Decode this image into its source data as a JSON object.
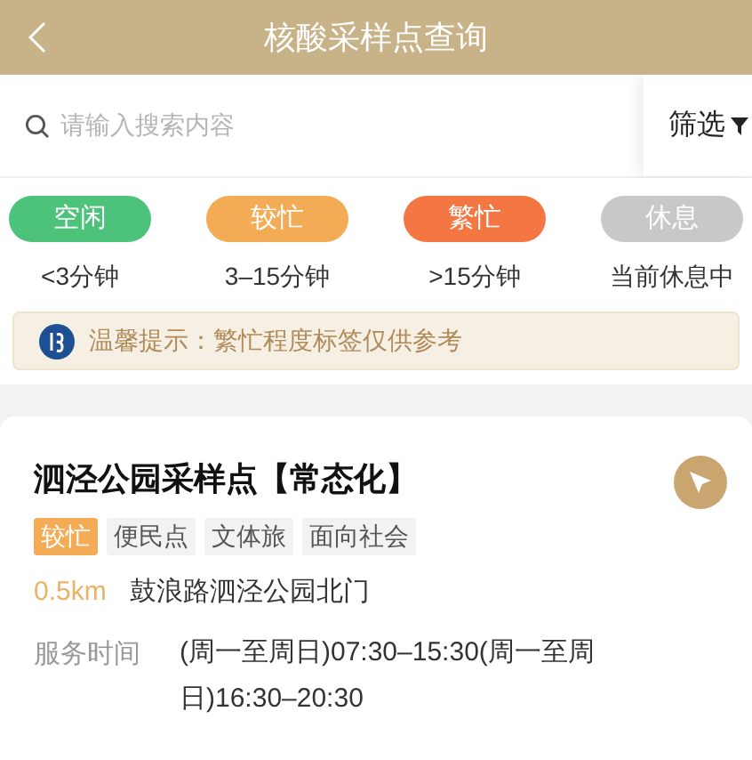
{
  "header": {
    "title": "核酸采样点查询"
  },
  "search": {
    "placeholder": "请输入搜索内容"
  },
  "filter": {
    "label": "筛选"
  },
  "legend": [
    {
      "label": "空闲",
      "color": "#4cc27a",
      "note": "<3分钟"
    },
    {
      "label": "较忙",
      "color": "#f4ab55",
      "note": "3–15分钟"
    },
    {
      "label": "繁忙",
      "color": "#f47643",
      "note": ">15分钟"
    },
    {
      "label": "休息",
      "color": "#c8c8c8",
      "note": "当前休息中"
    }
  ],
  "tip": {
    "text": "温馨提示：繁忙程度标签仅供参考"
  },
  "sites": [
    {
      "name": "泗泾公园采样点【常态化】",
      "tags": [
        {
          "label": "较忙",
          "kind": "status"
        },
        {
          "label": "便民点",
          "kind": "plain"
        },
        {
          "label": "文体旅",
          "kind": "plain"
        },
        {
          "label": "面向社会",
          "kind": "plain"
        }
      ],
      "distance": "0.5km",
      "address": "鼓浪路泗泾公园北门",
      "hours_label": "服务时间",
      "hours": "(周一至周日)07:30–15:30(周一至周日)16:30–20:30"
    }
  ]
}
